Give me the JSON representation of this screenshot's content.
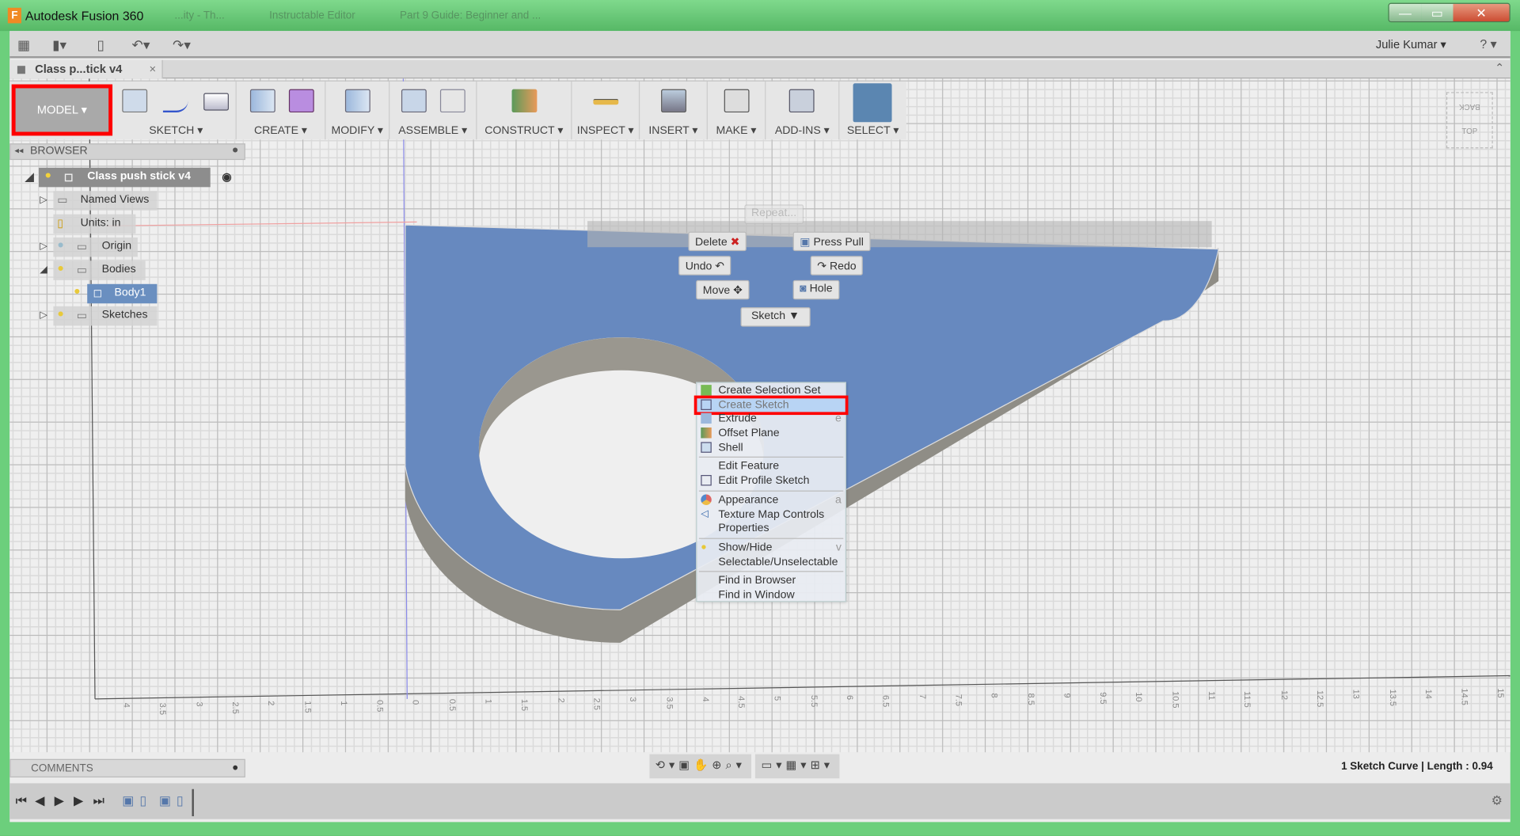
{
  "window": {
    "app_title": "Autodesk Fusion 360",
    "background_tabs": [
      "...ity - Th...",
      "Instructable Editor",
      "Part 9 Guide: Beginner and ..."
    ],
    "controls": [
      "minimize",
      "maximize",
      "close"
    ]
  },
  "quickbar": {
    "user": "Julie Kumar ▾",
    "help": "? ▾",
    "icons": [
      "grid-icon",
      "file-icon",
      "save-icon",
      "undo-icon",
      "redo-icon"
    ]
  },
  "document_tab": {
    "label": "Class p...tick v4",
    "close": "×"
  },
  "ribbon": {
    "workspace": "MODEL ▾",
    "groups": [
      {
        "label": "SKETCH ▾"
      },
      {
        "label": "CREATE ▾"
      },
      {
        "label": "MODIFY ▾"
      },
      {
        "label": "ASSEMBLE ▾"
      },
      {
        "label": "CONSTRUCT ▾"
      },
      {
        "label": "INSPECT ▾"
      },
      {
        "label": "INSERT ▾"
      },
      {
        "label": "MAKE ▾"
      },
      {
        "label": "ADD-INS ▾"
      },
      {
        "label": "SELECT ▾"
      }
    ],
    "highlight_color": "#ff0000"
  },
  "browser": {
    "title": "BROWSER",
    "items": [
      {
        "label": "Class push stick v4",
        "expanded": true
      },
      {
        "label": "Named Views"
      },
      {
        "label": "Units: in"
      },
      {
        "label": "Origin"
      },
      {
        "label": "Bodies",
        "expanded": true
      },
      {
        "label": "Body1",
        "selected": true
      },
      {
        "label": "Sketches"
      }
    ]
  },
  "marking_menu": {
    "repeat": "Repeat...",
    "delete": "Delete",
    "press_pull": "Press Pull",
    "undo": "Undo",
    "redo": "Redo",
    "move": "Move",
    "hole": "Hole",
    "sketch": "Sketch ▼"
  },
  "context_menu": {
    "groups": [
      [
        {
          "label": "Create Selection Set",
          "icon": "selection-set-icon"
        },
        {
          "label": "Create Sketch",
          "icon": "sketch-icon",
          "highlighted": true
        },
        {
          "label": "Extrude",
          "icon": "extrude-icon",
          "shortcut": "e"
        },
        {
          "label": "Offset Plane",
          "icon": "plane-icon"
        },
        {
          "label": "Shell",
          "icon": "shell-icon"
        }
      ],
      [
        {
          "label": "Edit Feature"
        },
        {
          "label": "Edit Profile Sketch",
          "icon": "sketch-icon"
        }
      ],
      [
        {
          "label": "Appearance",
          "icon": "appearance-icon",
          "shortcut": "a"
        },
        {
          "label": "Texture Map Controls",
          "icon": "texture-icon"
        },
        {
          "label": "Properties"
        }
      ],
      [
        {
          "label": "Show/Hide",
          "icon": "lightbulb-icon",
          "shortcut": "v"
        },
        {
          "label": "Selectable/Unselectable"
        }
      ],
      [
        {
          "label": "Find in Browser"
        },
        {
          "label": "Find in Window"
        }
      ]
    ]
  },
  "viewcube": {
    "back": "BACK",
    "top": "TOP"
  },
  "ruler": [
    "4",
    "3.5",
    "3",
    "2.5",
    "2",
    "1.5",
    "1",
    "0.5",
    "0",
    "0.5",
    "1",
    "1.5",
    "2",
    "2.5",
    "3",
    "3.5",
    "4",
    "4.5",
    "5",
    "5.5",
    "6",
    "6.5",
    "7",
    "7.5",
    "8",
    "8.5",
    "9",
    "9.5",
    "10",
    "10.5",
    "11",
    "11.5",
    "12",
    "12.5",
    "13",
    "13.5",
    "14",
    "14.5",
    "15"
  ],
  "comments": {
    "title": "COMMENTS"
  },
  "status": "1 Sketch Curve | Length : 0.94",
  "colors": {
    "body_face": "#6789bf",
    "body_side": "#8c8a82",
    "title_bar": "#5fbf6f"
  }
}
